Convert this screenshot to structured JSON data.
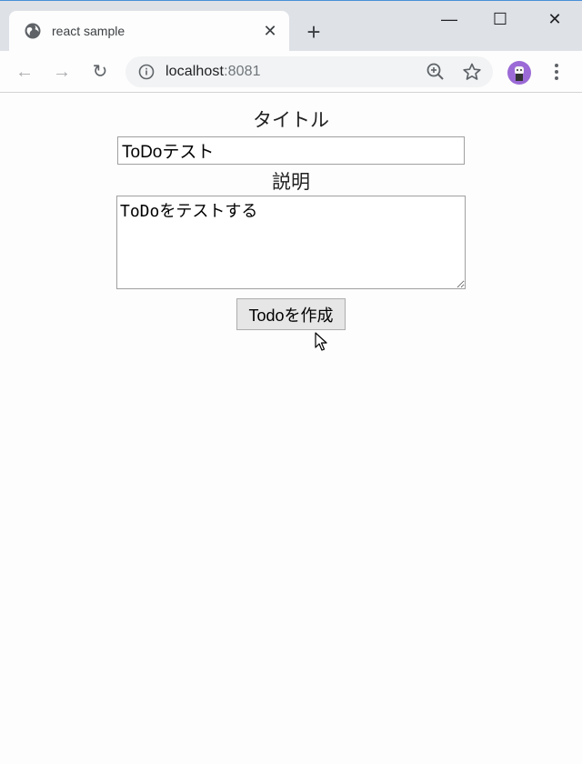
{
  "browser": {
    "tab": {
      "title": "react sample",
      "close_glyph": "✕",
      "favicon": "globe-icon"
    },
    "new_tab_glyph": "+",
    "window_controls": {
      "minimize": "—",
      "maximize": "☐",
      "close": "✕"
    },
    "nav": {
      "back": "←",
      "forward": "→",
      "reload": "↻"
    },
    "address": {
      "host": "localhost",
      "port": ":8081"
    },
    "icons": [
      "info-icon",
      "zoom-icon",
      "star-icon",
      "avatar",
      "menu-icon"
    ]
  },
  "form": {
    "title_label": "タイトル",
    "title_value": "ToDoテスト",
    "description_label": "説明",
    "description_value": "ToDoをテストする",
    "submit_label": "Todoを作成"
  },
  "colors": {
    "tabstrip": "#dee1e6",
    "page_bg": "#fdfdfd",
    "avatar": "#9b6ad6",
    "button_bg": "#e6e6e6"
  }
}
